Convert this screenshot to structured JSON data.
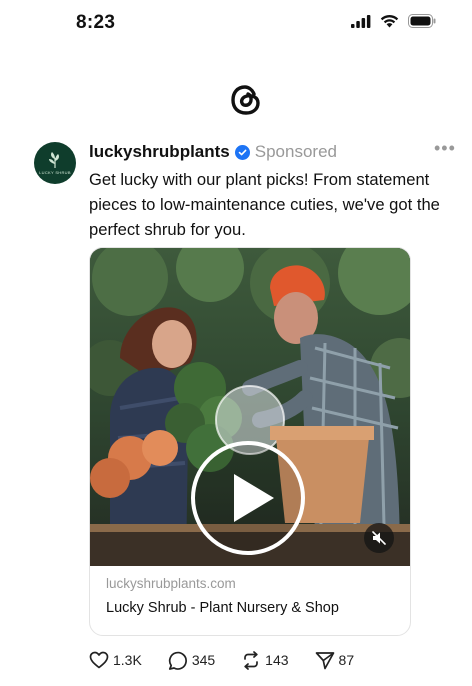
{
  "status_bar": {
    "time": "8:23"
  },
  "app": {
    "logo_icon": "threads-icon"
  },
  "post": {
    "username": "lucky­shrubplants",
    "sponsored_label": "Sponsored",
    "more_label": "•••",
    "caption": "Get lucky with our plant picks! From statement pieces to low-maintenance cuties, we've got the perfect shrub for you.",
    "avatar_text": "LUCKY SHRUB",
    "link": {
      "domain": "luckyshrubplants.com",
      "title": "Lucky Shrub - Plant Nursery & Shop"
    },
    "actions": {
      "likes": "1.3K",
      "replies": "345",
      "reposts": "143",
      "shares": "87"
    }
  },
  "colors": {
    "verified": "#1d74f5",
    "avatar_bg": "#0f3d2c"
  }
}
